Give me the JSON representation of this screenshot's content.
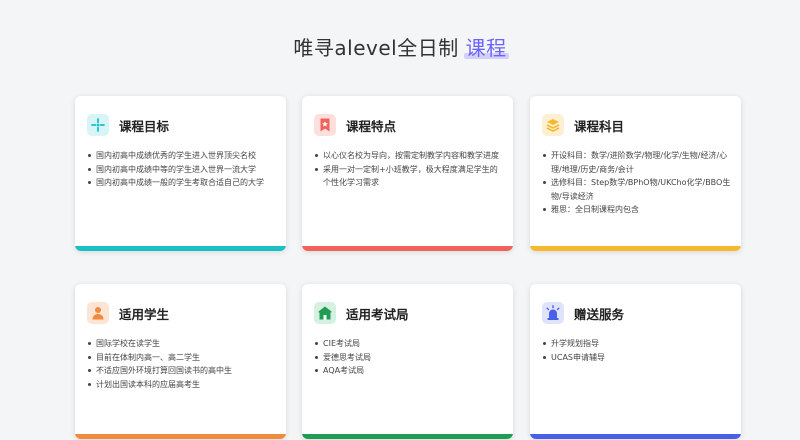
{
  "header": {
    "title_prefix": "唯寻alevel全日制",
    "title_highlight": "课程"
  },
  "cards": [
    {
      "title": "课程目标",
      "icon": "target-icon",
      "accent": "#1bbfc6",
      "icon_bg": "#d7f4f6",
      "items": [
        "国内初高中成绩优秀的学生进入世界顶尖名校",
        "国内初高中成绩中等的学生进入世界一流大学",
        "国内初高中成绩一般的学生考取合适自己的大学"
      ]
    },
    {
      "title": "课程特点",
      "icon": "bookmark-star-icon",
      "accent": "#f0625a",
      "icon_bg": "#fde0de",
      "items": [
        "以心仪名校为导向，按需定制教学内容和教学进度",
        "采用一对一定制+小班教学，极大程度满足学生的个性化学习需求"
      ]
    },
    {
      "title": "课程科目",
      "icon": "books-stack-icon",
      "accent": "#f5b82e",
      "icon_bg": "#fdf0d2",
      "items": [
        "开设科目：数学/进阶数学/物理/化学/生物/经济/心理/地理/历史/商务/会计",
        "选修科目：Step数学/BPhO物/UKCho化学/BBO生物/导读经济",
        "雅思：全日制课程内包含"
      ]
    },
    {
      "title": "适用学生",
      "icon": "student-icon",
      "accent": "#f08a3c",
      "icon_bg": "#fde4d3",
      "items": [
        "国际学校在读学生",
        "目前在体制内高一、高二学生",
        "不适应国外环境打算回国读书的高中生",
        "计划出国读本科的应届高考生"
      ]
    },
    {
      "title": "适用考试局",
      "icon": "school-building-icon",
      "accent": "#1f9d55",
      "icon_bg": "#d6f1e1",
      "items": [
        "CIE考试局",
        "爱德思考试局",
        "AQA考试局"
      ]
    },
    {
      "title": "赠送服务",
      "icon": "alarm-light-icon",
      "accent": "#4a5fe8",
      "icon_bg": "#dfe3fc",
      "items": [
        "升学规划指导",
        "UCAS申请辅导"
      ]
    }
  ]
}
